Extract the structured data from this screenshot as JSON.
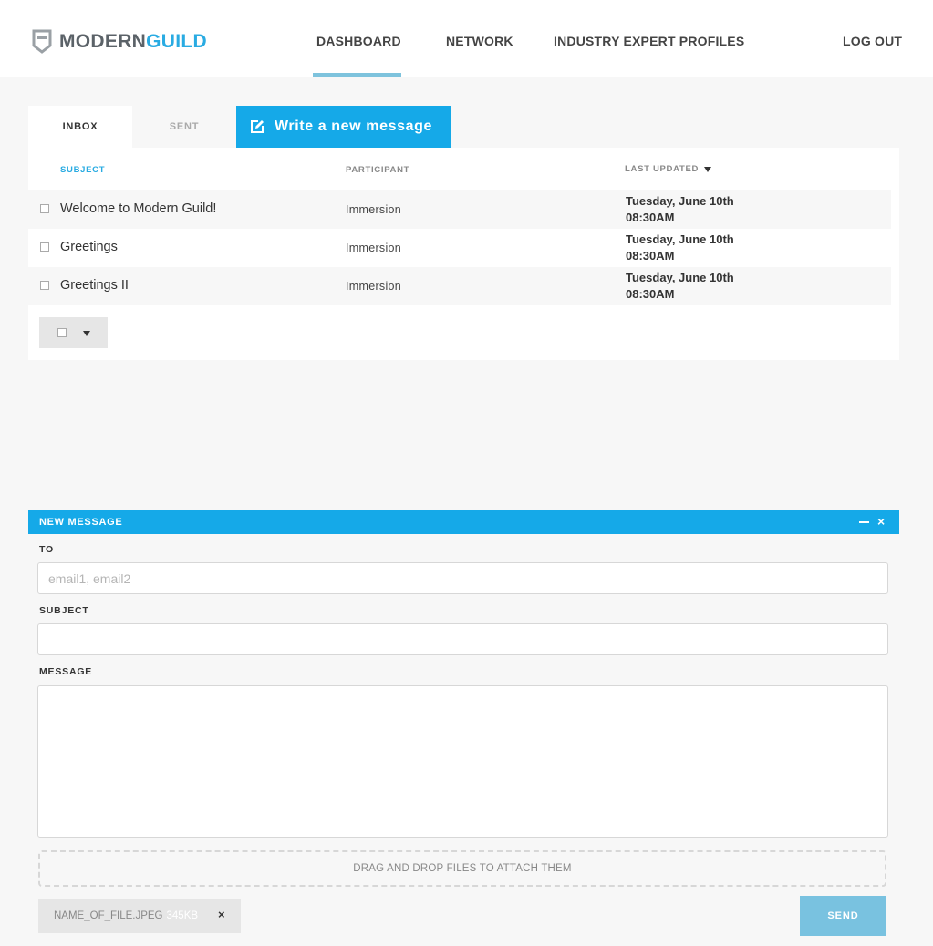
{
  "brand": {
    "name_part1": "MODERN",
    "name_part2": "GUILD",
    "primary_color": "#15a9e8",
    "accent_color": "#29abe2"
  },
  "nav": {
    "items": [
      {
        "label": "DASHBOARD",
        "active": true
      },
      {
        "label": "NETWORK",
        "active": false
      },
      {
        "label": "INDUSTRY EXPERT PROFILES",
        "active": false
      }
    ],
    "logout_label": "LOG OUT"
  },
  "tabs": [
    {
      "label": "INBOX",
      "active": true
    },
    {
      "label": "SENT",
      "active": false
    }
  ],
  "write_button": {
    "label": "Write a new message",
    "icon": "edit-icon"
  },
  "inbox": {
    "columns": {
      "subject": "SUBJECT",
      "participant": "PARTICIPANT",
      "last_updated": "LAST UPDATED"
    },
    "sort": {
      "column": "last_updated",
      "direction": "desc"
    },
    "rows": [
      {
        "subject": "Welcome to Modern Guild!",
        "participant": "Immersion",
        "date": "Tuesday, June 10th",
        "time": "08:30AM",
        "checked": false
      },
      {
        "subject": "Greetings",
        "participant": "Immersion",
        "date": "Tuesday, June 10th",
        "time": "08:30AM",
        "checked": false
      },
      {
        "subject": "Greetings II",
        "participant": "Immersion",
        "date": "Tuesday, June 10th",
        "time": "08:30AM",
        "checked": false
      }
    ]
  },
  "new_message": {
    "title": "NEW MESSAGE",
    "minimize_icon": "minimize-icon",
    "close_icon": "close-icon",
    "close_glyph": "×",
    "to_label": "TO",
    "to_placeholder": "email1, email2",
    "to_value": "",
    "subject_label": "SUBJECT",
    "subject_value": "",
    "message_label": "MESSAGE",
    "message_value": "",
    "dropzone_text": "DRAG AND DROP FILES TO ATTACH THEM",
    "attachment": {
      "filename": "NAME_OF_FILE.JPEG",
      "size": "345KB",
      "remove_glyph": "×"
    },
    "send_label": "SEND"
  }
}
